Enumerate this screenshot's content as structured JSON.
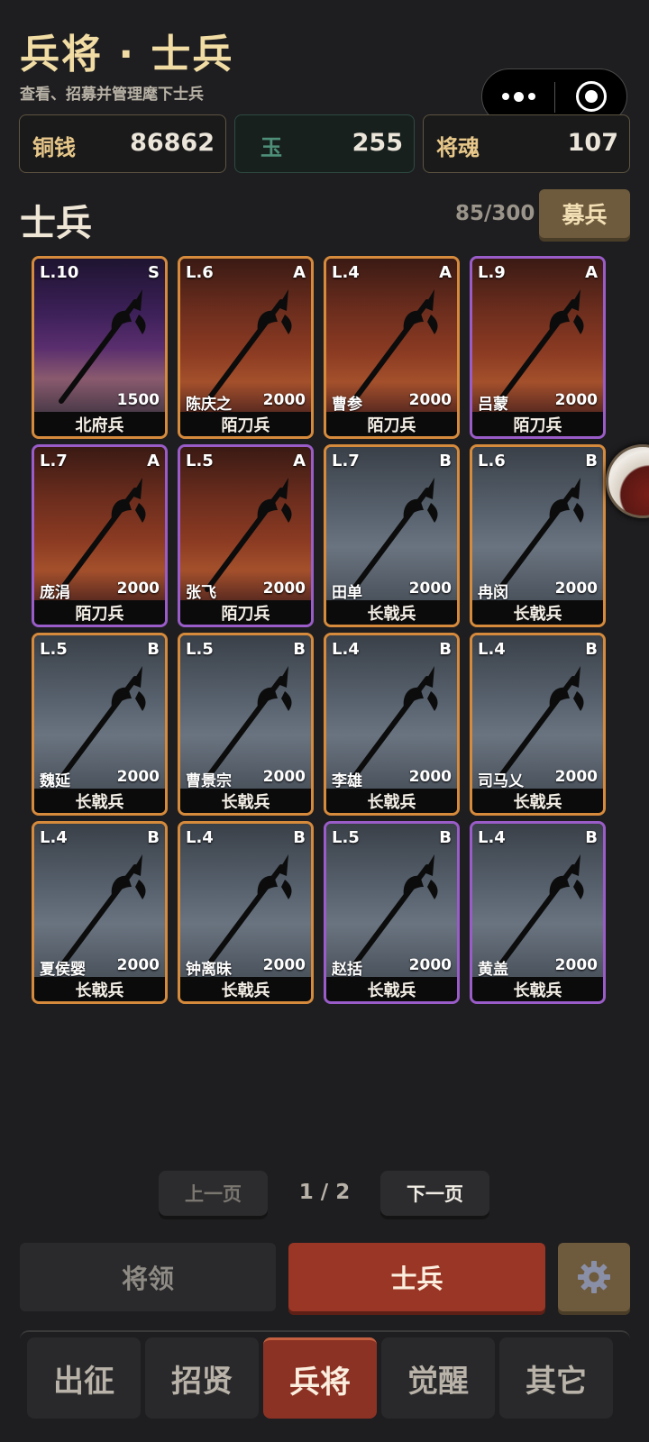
{
  "header": {
    "title": "兵将 · 士兵",
    "subtitle": "查看、招募并管理麾下士兵"
  },
  "resources": {
    "copper": {
      "label": "铜钱",
      "value": "86862"
    },
    "jade": {
      "label": "玉",
      "value": "255"
    },
    "soul": {
      "label": "将魂",
      "value": "107"
    }
  },
  "section": {
    "title": "士兵",
    "count": "85/300",
    "recruit_label": "募兵"
  },
  "soldiers": [
    {
      "level": "L.10",
      "grade": "S",
      "general": "",
      "power": "1500",
      "type": "北府兵",
      "bg": "purple",
      "frame": "orange"
    },
    {
      "level": "L.6",
      "grade": "A",
      "general": "陈庆之",
      "power": "2000",
      "type": "陌刀兵",
      "bg": "red",
      "frame": "orange"
    },
    {
      "level": "L.4",
      "grade": "A",
      "general": "曹参",
      "power": "2000",
      "type": "陌刀兵",
      "bg": "red",
      "frame": "orange"
    },
    {
      "level": "L.9",
      "grade": "A",
      "general": "吕蒙",
      "power": "2000",
      "type": "陌刀兵",
      "bg": "red",
      "frame": "purple"
    },
    {
      "level": "L.7",
      "grade": "A",
      "general": "庞涓",
      "power": "2000",
      "type": "陌刀兵",
      "bg": "red",
      "frame": "purple"
    },
    {
      "level": "L.5",
      "grade": "A",
      "general": "张飞",
      "power": "2000",
      "type": "陌刀兵",
      "bg": "red",
      "frame": "purple"
    },
    {
      "level": "L.7",
      "grade": "B",
      "general": "田单",
      "power": "2000",
      "type": "长戟兵",
      "bg": "blue",
      "frame": "orange"
    },
    {
      "level": "L.6",
      "grade": "B",
      "general": "冉闵",
      "power": "2000",
      "type": "长戟兵",
      "bg": "blue",
      "frame": "orange"
    },
    {
      "level": "L.5",
      "grade": "B",
      "general": "魏延",
      "power": "2000",
      "type": "长戟兵",
      "bg": "blue",
      "frame": "orange"
    },
    {
      "level": "L.5",
      "grade": "B",
      "general": "曹景宗",
      "power": "2000",
      "type": "长戟兵",
      "bg": "blue",
      "frame": "orange"
    },
    {
      "level": "L.4",
      "grade": "B",
      "general": "李雄",
      "power": "2000",
      "type": "长戟兵",
      "bg": "blue",
      "frame": "orange"
    },
    {
      "level": "L.4",
      "grade": "B",
      "general": "司马乂",
      "power": "2000",
      "type": "长戟兵",
      "bg": "blue",
      "frame": "orange"
    },
    {
      "level": "L.4",
      "grade": "B",
      "general": "夏侯婴",
      "power": "2000",
      "type": "长戟兵",
      "bg": "blue",
      "frame": "orange"
    },
    {
      "level": "L.4",
      "grade": "B",
      "general": "钟离昧",
      "power": "2000",
      "type": "长戟兵",
      "bg": "blue",
      "frame": "orange"
    },
    {
      "level": "L.5",
      "grade": "B",
      "general": "赵括",
      "power": "2000",
      "type": "长戟兵",
      "bg": "blue",
      "frame": "purple"
    },
    {
      "level": "L.4",
      "grade": "B",
      "general": "黄盖",
      "power": "2000",
      "type": "长戟兵",
      "bg": "blue",
      "frame": "purple"
    }
  ],
  "pagination": {
    "prev_label": "上一页",
    "indicator": "1 / 2",
    "next_label": "下一页"
  },
  "subtabs": {
    "generals_label": "将领",
    "soldiers_label": "士兵"
  },
  "nav": [
    {
      "label": "出征",
      "active": false
    },
    {
      "label": "招贤",
      "active": false
    },
    {
      "label": "兵将",
      "active": true
    },
    {
      "label": "觉醒",
      "active": false
    },
    {
      "label": "其它",
      "active": false
    }
  ],
  "colors": {
    "accent_gold": "#f1dca4",
    "active_red": "#9a3626",
    "frame_orange": "#d68a3c",
    "frame_purple": "#9a5cc8",
    "button_bronze": "#6e5a3c"
  },
  "icons": {
    "capsule_more": "more-dots-icon",
    "capsule_close": "target-circle-icon",
    "settings": "gear-icon",
    "soldier_art": "halberd-icon"
  }
}
